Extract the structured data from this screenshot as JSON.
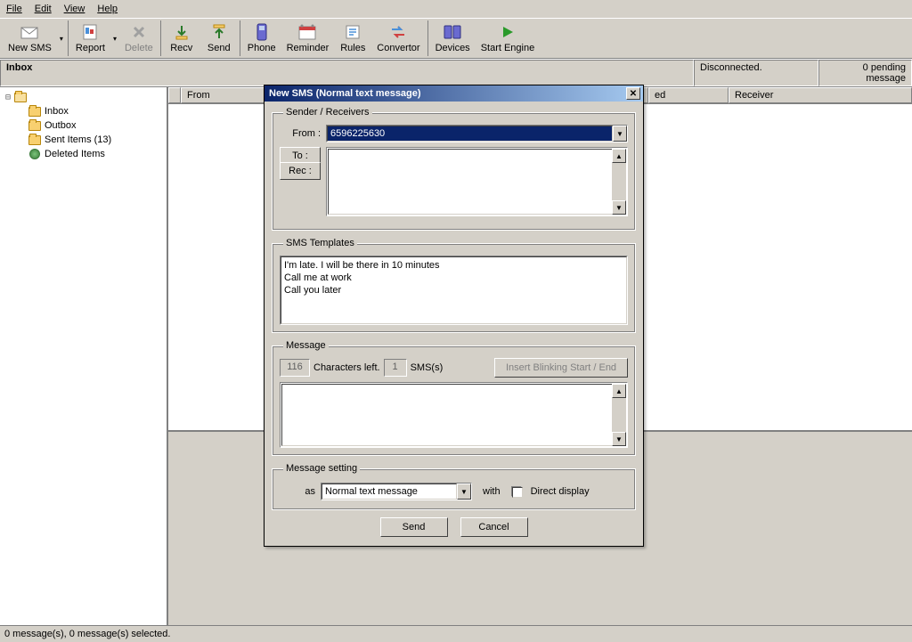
{
  "menu": {
    "file": "File",
    "edit": "Edit",
    "view": "View",
    "help": "Help"
  },
  "toolbar": {
    "new_sms": "New SMS",
    "report": "Report",
    "delete": "Delete",
    "recv": "Recv",
    "send": "Send",
    "phone": "Phone",
    "reminder": "Reminder",
    "rules": "Rules",
    "convertor": "Convertor",
    "devices": "Devices",
    "start_engine": "Start Engine"
  },
  "status": {
    "inbox_title": "Inbox",
    "disconnected": "Disconnected.",
    "pending": "0 pending message"
  },
  "tree": {
    "inbox": "Inbox",
    "outbox": "Outbox",
    "sent": "Sent Items (13)",
    "deleted": "Deleted Items"
  },
  "grid": {
    "from": "From",
    "received": "ed",
    "receiver": "Receiver"
  },
  "dialog": {
    "title": "New SMS (Normal text message)",
    "group_sender": "Sender / Receivers",
    "from_label": "From :",
    "from_value": "6596225630",
    "to_label": "To :",
    "rec_label": "Rec :",
    "group_templates": "SMS Templates",
    "templates": [
      "I'm late. I will be there in 10 minutes",
      "Call me at work",
      "Call you later"
    ],
    "group_message": "Message",
    "chars_left_value": "116",
    "chars_left_label": "Characters left.",
    "sms_count": "1",
    "sms_label": "SMS(s)",
    "blinking_btn": "Insert Blinking Start / End",
    "group_setting": "Message setting",
    "as_label": "as",
    "as_value": "Normal text message",
    "with_label": "with",
    "direct_display": "Direct display",
    "send_btn": "Send",
    "cancel_btn": "Cancel"
  },
  "statusbar": "0 message(s), 0 message(s) selected."
}
